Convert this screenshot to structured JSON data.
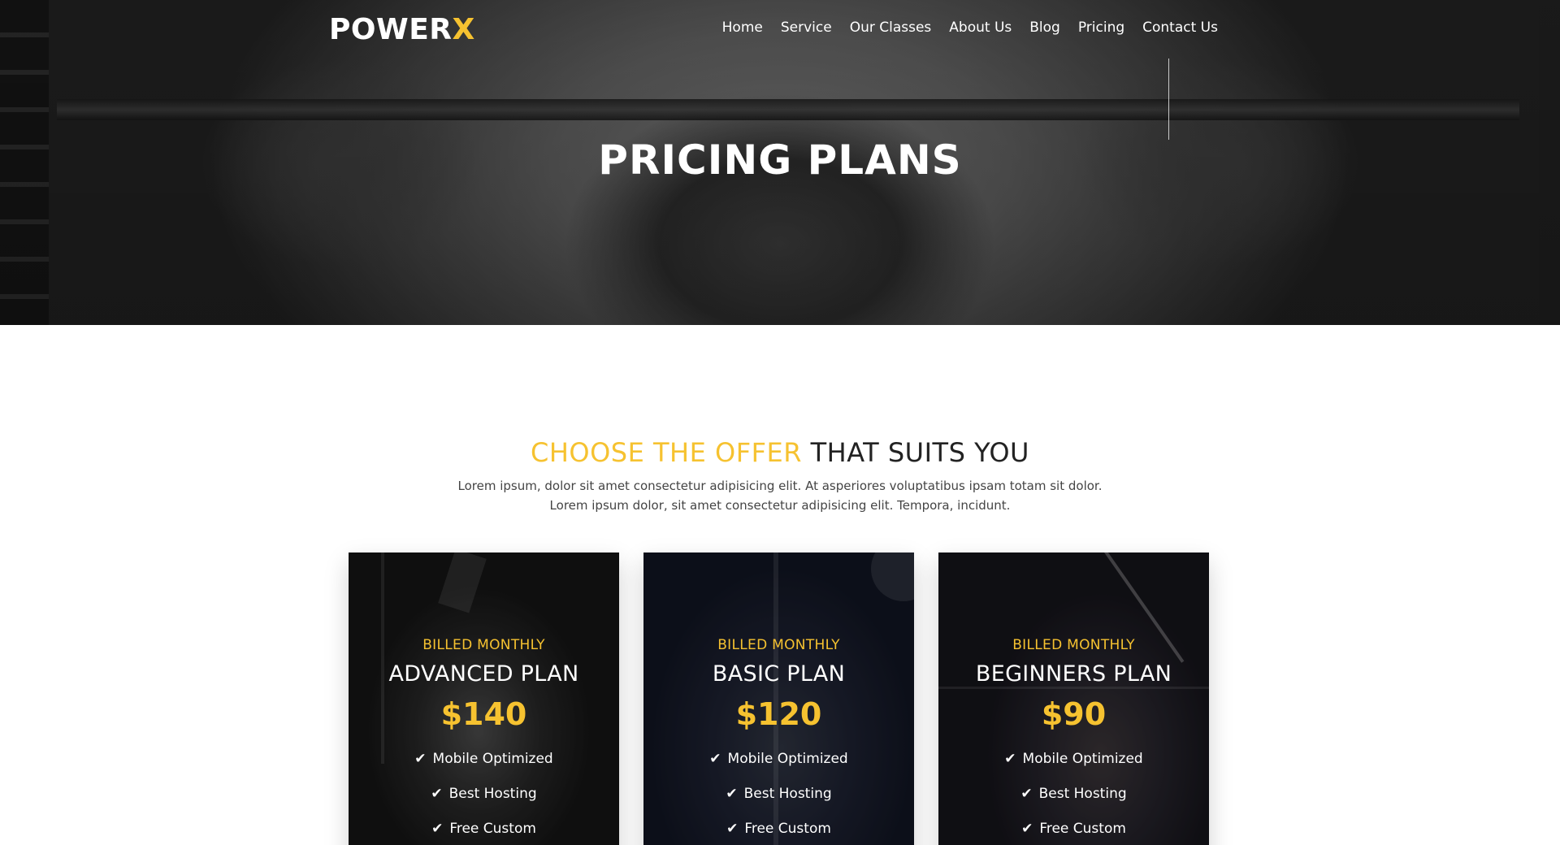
{
  "brand": {
    "name_main": "POWER",
    "name_accent": "X"
  },
  "nav": {
    "items": [
      "Home",
      "Service",
      "Our Classes",
      "About Us",
      "Blog",
      "Pricing",
      "Contact Us"
    ]
  },
  "hero": {
    "title": "PRICING PLANS"
  },
  "section": {
    "title_highlight": "CHOOSE THE OFFER",
    "title_rest": "THAT SUITS YOU",
    "desc_line1": "Lorem ipsum, dolor sit amet consectetur adipisicing elit. At asperiores voluptatibus ipsam totam sit dolor.",
    "desc_line2": "Lorem ipsum dolor, sit amet consectetur adipisicing elit. Tempora, incidunt."
  },
  "plans": [
    {
      "billed": "BILLED MONTHLY",
      "name": "ADVANCED PLAN",
      "price": "$140",
      "features": [
        "Mobile Optimized",
        "Best Hosting",
        "Free Custom"
      ]
    },
    {
      "billed": "BILLED MONTHLY",
      "name": "BASIC PLAN",
      "price": "$120",
      "features": [
        "Mobile Optimized",
        "Best Hosting",
        "Free Custom"
      ]
    },
    {
      "billed": "BILLED MONTHLY",
      "name": "BEGINNERS PLAN",
      "price": "$90",
      "features": [
        "Mobile Optimized",
        "Best Hosting",
        "Free Custom"
      ]
    }
  ],
  "icons": {
    "feature": "check-icon"
  },
  "colors": {
    "accent": "#f6c230",
    "text_dark": "#222222"
  }
}
